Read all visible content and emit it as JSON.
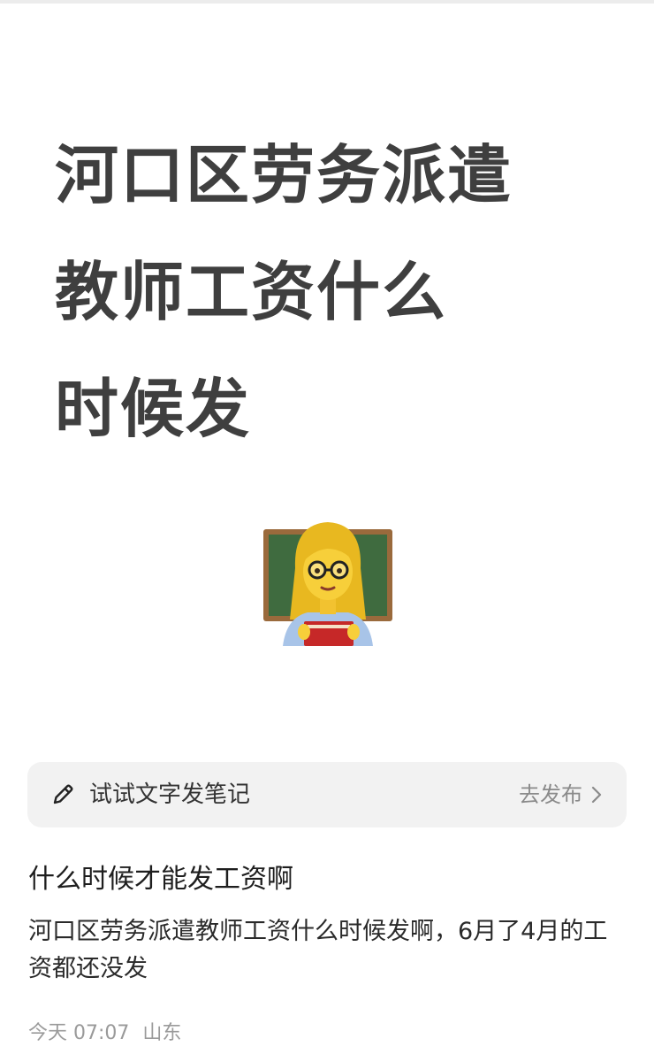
{
  "cover": {
    "title_lines": [
      "河口区劳务派遣",
      "教师工资什么",
      "时候发"
    ],
    "emoji": "woman-teacher-emoji"
  },
  "compose": {
    "label": "试试文字发笔记",
    "action": "去发布",
    "icon": "pencil-icon",
    "chevron": "chevron-right-icon"
  },
  "post": {
    "title": "什么时候才能发工资啊",
    "body": "河口区劳务派遣教师工资什么时候发啊，6月了4月的工资都还没发",
    "time": "今天 07:07",
    "location": "山东"
  },
  "colors": {
    "title": "#3f3f3f",
    "compose_bg": "#f2f2f2",
    "meta": "#9a9a9a"
  }
}
